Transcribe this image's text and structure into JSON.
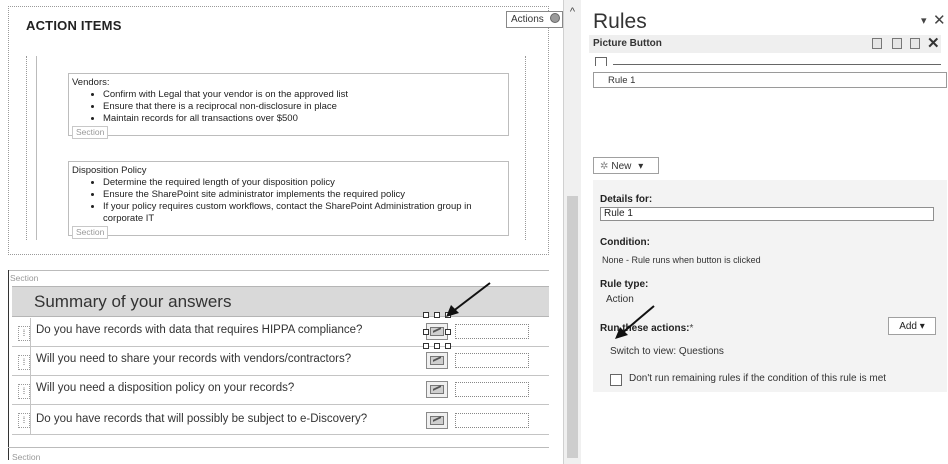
{
  "form": {
    "action_items_title": "ACTION ITEMS",
    "actions_tag": "Actions",
    "vendors": {
      "heading": "Vendors:",
      "bullets": [
        "Confirm with Legal that your vendor is on the approved list",
        "Ensure that there is a reciprocal non-disclosure in place",
        "Maintain records for all transactions over $500"
      ],
      "section_tag": "Section"
    },
    "disposition": {
      "heading": "Disposition Policy",
      "bullets": [
        "Determine the required length of your disposition policy",
        "Ensure the SharePoint site administrator implements the required policy",
        "If your policy requires custom workflows, contact the SharePoint Administration group in corporate IT"
      ],
      "section_tag": "Section"
    },
    "section_strip_label": "Section",
    "summary_title": "Summary of your answers",
    "questions": [
      "Do you have records with data that requires HIPPA compliance?",
      "Will you need to share your records with vendors/contractors?",
      "Will you need a disposition policy on your records?",
      "Do you have records that will possibly be subject to e-Discovery?"
    ],
    "bottom_section_label": "Section"
  },
  "rules_pane": {
    "title": "Rules",
    "menu_glyph": "▾",
    "close_glyph": "✕",
    "control_name": "Picture Button",
    "delete_glyph": "✕",
    "rule_item": "Rule 1",
    "new_button": "New",
    "new_star": "✲",
    "dropdown_glyph": "▾",
    "details_for_label": "Details for:",
    "rule_name_value": "Rule 1",
    "condition_label": "Condition:",
    "condition_text": "None - Rule runs when button is clicked",
    "rule_type_label": "Rule type:",
    "rule_type_value": "Action",
    "run_actions_label": "Run these actions:",
    "required_mark": "*",
    "add_button": "Add",
    "action_text": "Switch to view: Questions",
    "stop_rules_label": "Don't run remaining rules if the condition of this rule is met"
  },
  "scrollbar": {
    "up_glyph": "^"
  }
}
